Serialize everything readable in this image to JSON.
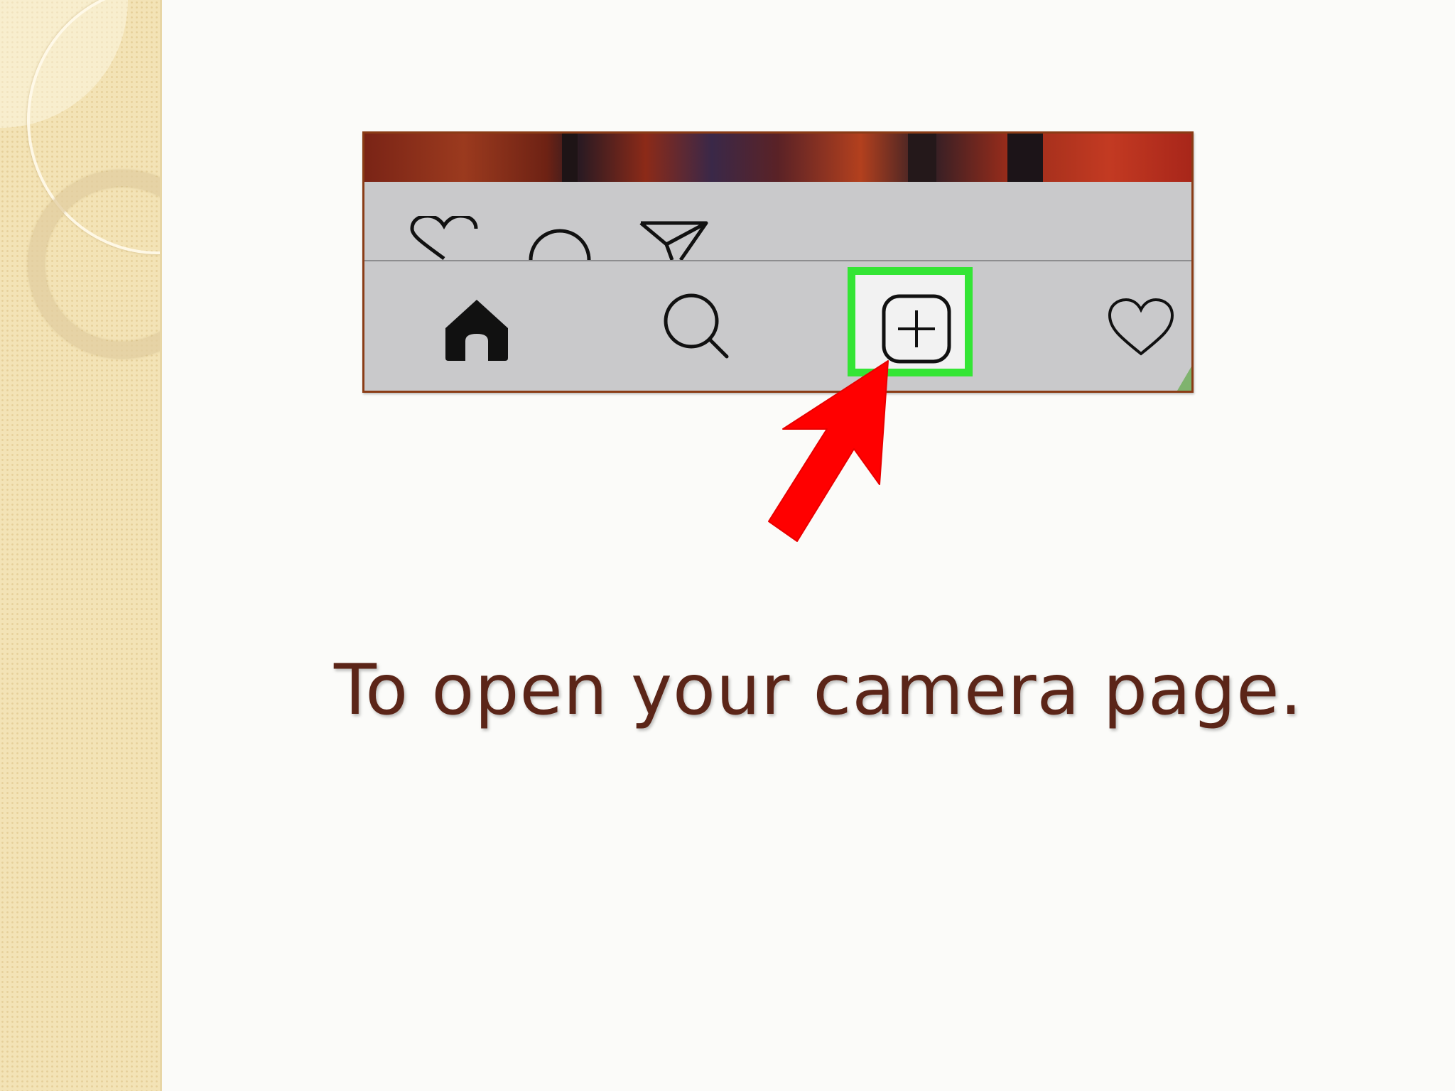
{
  "slide": {
    "caption": "To open your camera page.",
    "colors": {
      "caption": "#5b2518",
      "highlight": "#34e535",
      "arrow": "#ff0000",
      "panel_border": "#8a3c16",
      "side_band": "#f3e3b6"
    }
  },
  "screenshot": {
    "post_actions": [
      "heart-icon",
      "comment-icon",
      "share-icon"
    ],
    "tab_bar": [
      "home-icon",
      "search-icon",
      "new-post-icon",
      "activity-heart-icon"
    ],
    "highlighted_tab": "new-post-icon"
  }
}
